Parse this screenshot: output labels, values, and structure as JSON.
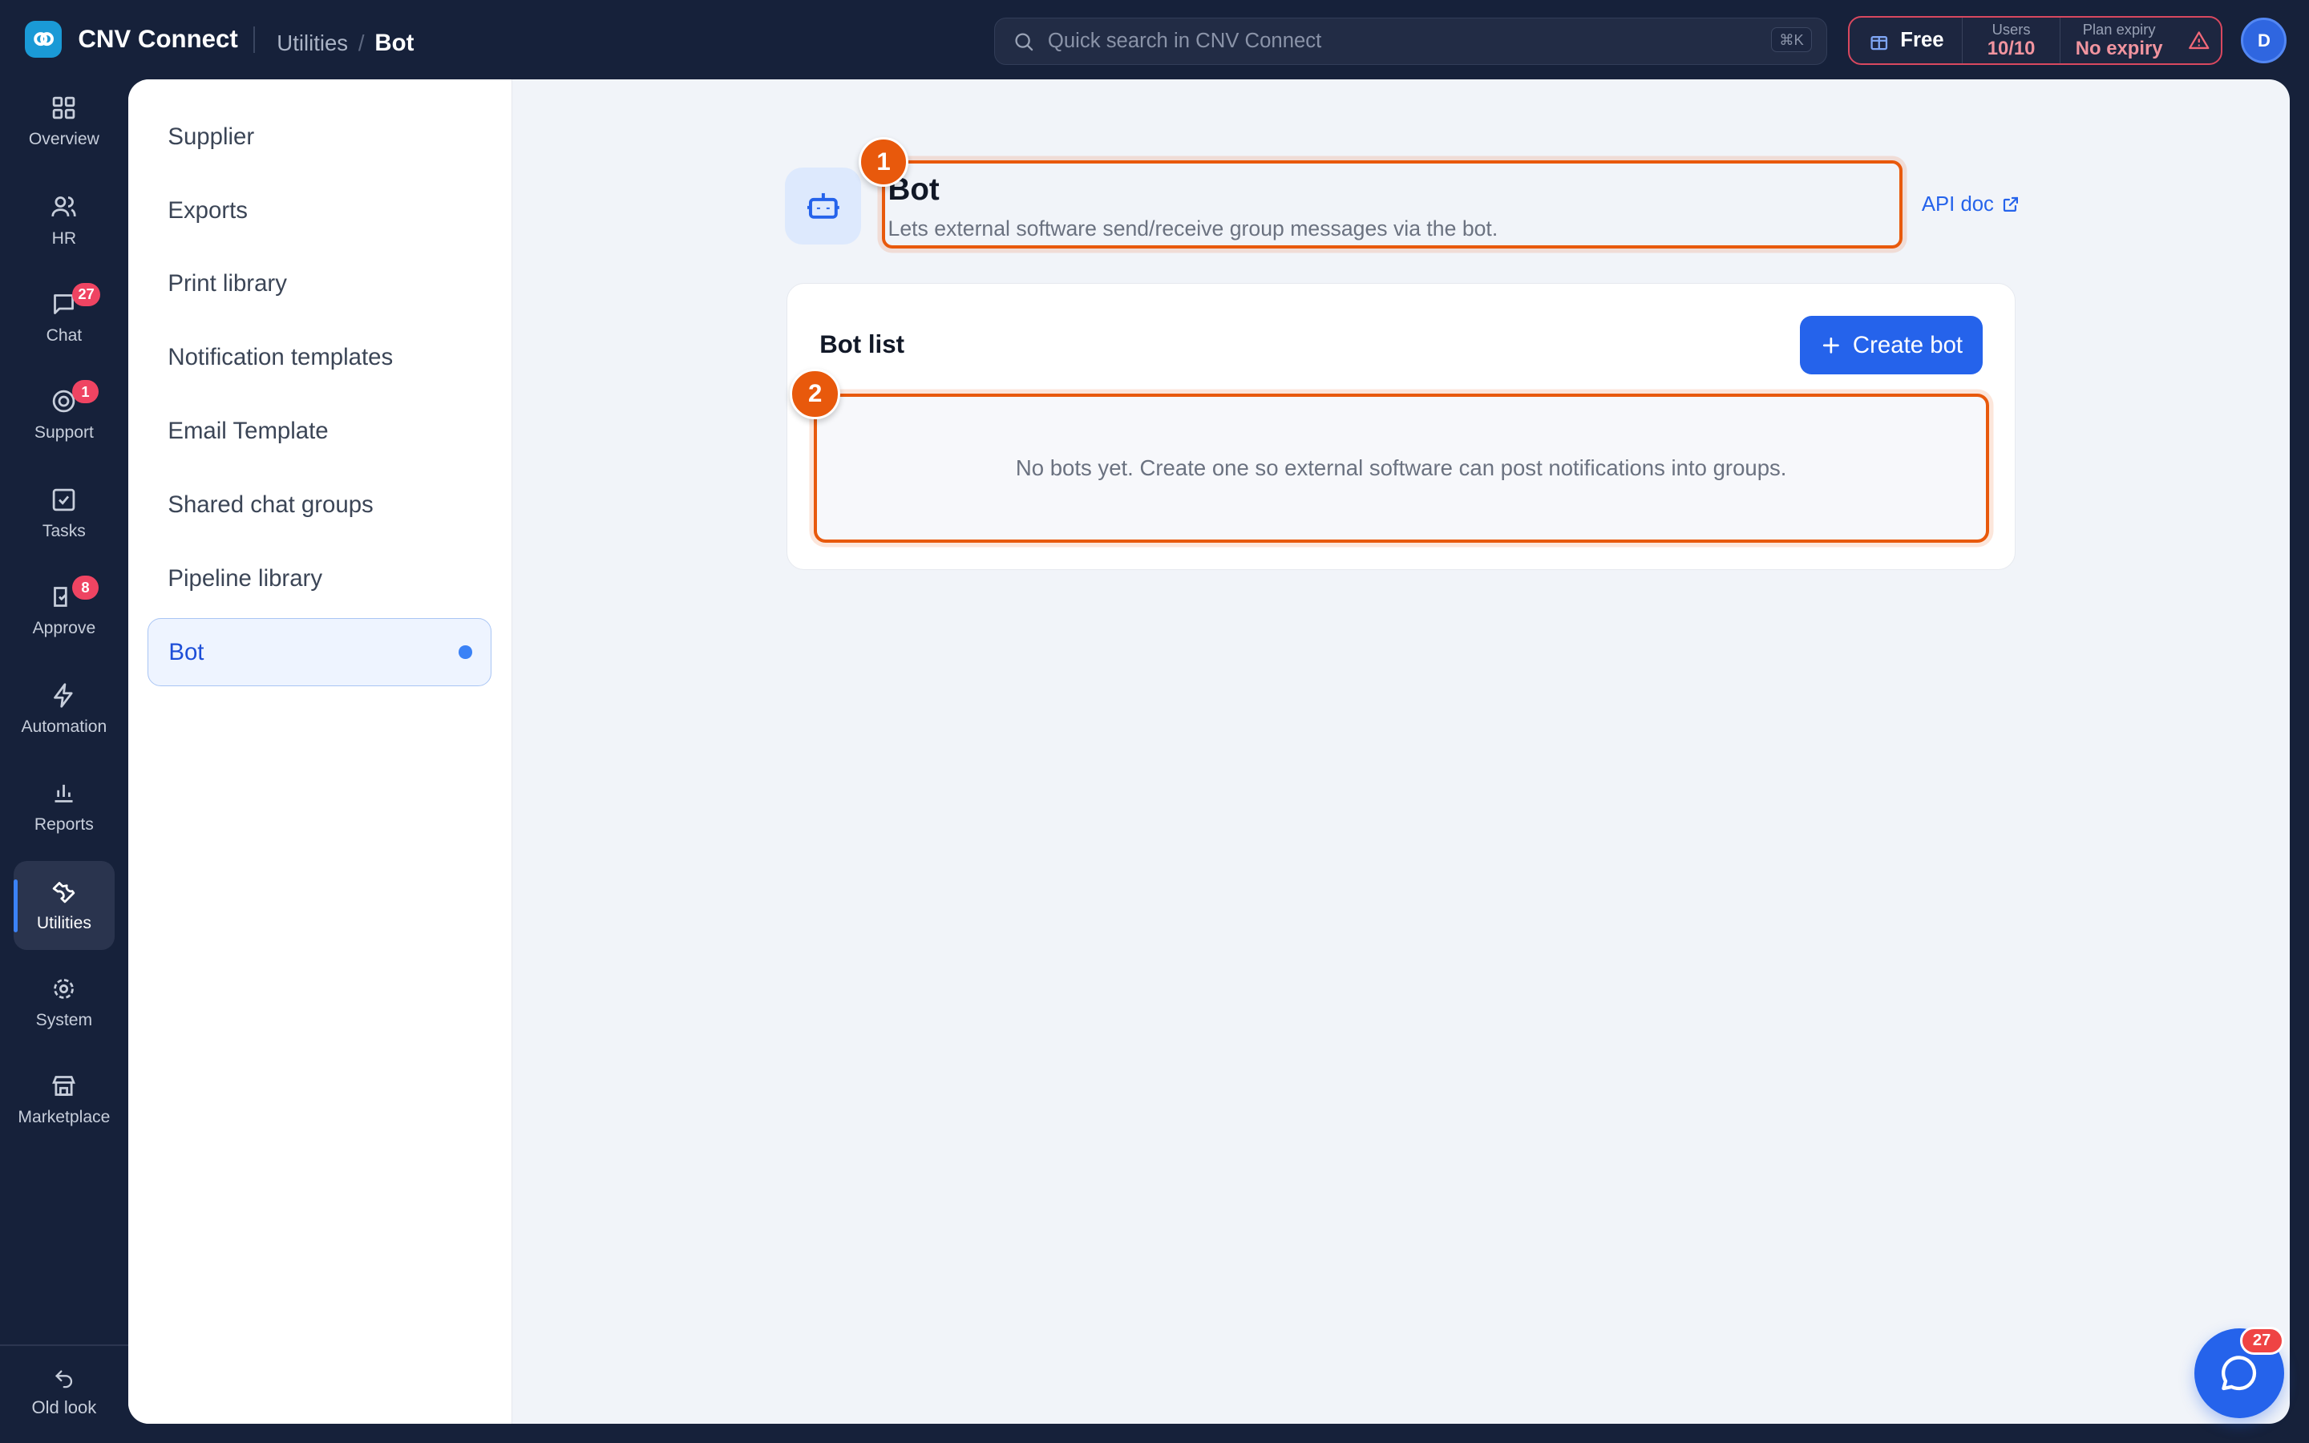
{
  "app": {
    "name": "CNV Connect"
  },
  "breadcrumb": {
    "parent": "Utilities",
    "separator": "/",
    "current": "Bot"
  },
  "search": {
    "placeholder": "Quick search in CNV Connect",
    "shortcut": "⌘K"
  },
  "plan": {
    "name": "Free",
    "users_label": "Users",
    "users_value": "10/10",
    "expiry_label": "Plan expiry",
    "expiry_value": "No expiry"
  },
  "user": {
    "initial": "D"
  },
  "rail": {
    "items": [
      {
        "label": "Overview",
        "icon": "grid-icon"
      },
      {
        "label": "HR",
        "icon": "users-icon"
      },
      {
        "label": "Chat",
        "icon": "chat-icon",
        "badge": "27"
      },
      {
        "label": "Support",
        "icon": "support-icon",
        "badge": "1"
      },
      {
        "label": "Tasks",
        "icon": "check-square-icon"
      },
      {
        "label": "Approve",
        "icon": "approve-icon",
        "badge": "8"
      },
      {
        "label": "Automation",
        "icon": "bolt-icon"
      },
      {
        "label": "Reports",
        "icon": "bar-chart-icon"
      },
      {
        "label": "Utilities",
        "icon": "wrench-icon",
        "active": true
      },
      {
        "label": "System",
        "icon": "gear-icon"
      },
      {
        "label": "Marketplace",
        "icon": "store-icon"
      }
    ],
    "old_look": "Old look"
  },
  "subnav": {
    "items": [
      "Supplier",
      "Exports",
      "Print library",
      "Notification templates",
      "Email Template",
      "Shared chat groups",
      "Pipeline library",
      "Bot"
    ],
    "active": "Bot"
  },
  "page": {
    "title": "Bot",
    "subtitle": "Lets external software send/receive group messages via the bot.",
    "api_doc": "API doc"
  },
  "bot_list": {
    "title": "Bot list",
    "create_label": "Create bot",
    "empty_text": "No bots yet. Create one so external software can post notifications into groups."
  },
  "markers": [
    "1",
    "2"
  ],
  "chat_fab": {
    "badge": "27"
  },
  "colors": {
    "accent": "#2563eb",
    "highlight": "#e8590c",
    "badge": "#ef4462",
    "sidebar_bg": "#16213a"
  }
}
